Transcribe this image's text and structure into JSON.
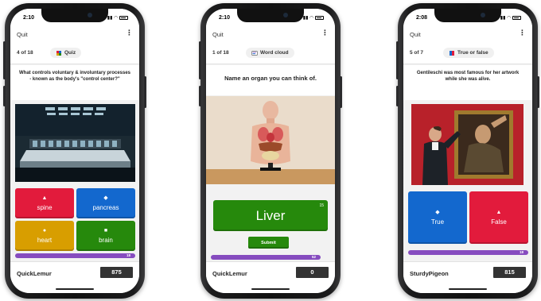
{
  "phones": [
    {
      "status_time": "2:10",
      "quit_label": "Quit",
      "counter": "4 of 18",
      "type_label": "Quiz",
      "question": "What controls voluntary & involuntary processes - known as the body's \"control center?\"",
      "answers": [
        {
          "label": "spine",
          "shape": "▲",
          "color": "#e21b3c"
        },
        {
          "label": "pancreas",
          "shape": "◆",
          "color": "#1368ce"
        },
        {
          "label": "heart",
          "shape": "●",
          "color": "#d89e00"
        },
        {
          "label": "brain",
          "shape": "■",
          "color": "#26890c"
        }
      ],
      "progress": {
        "value": "18",
        "fraction": 1.0
      },
      "player_name": "QuickLemur",
      "score": "875"
    },
    {
      "status_time": "2:10",
      "quit_label": "Quit",
      "counter": "1 of 18",
      "type_label": "Word cloud",
      "question": "Name an organ you can think of.",
      "answer_text": "Liver",
      "char_count": "15",
      "submit_label": "Submit",
      "progress": {
        "value": "52",
        "fraction": 1.0
      },
      "player_name": "QuickLemur",
      "score": "0"
    },
    {
      "status_time": "2:08",
      "quit_label": "Quit",
      "counter": "5 of 7",
      "type_label": "True or false",
      "question": "Gentileschi was most famous for her artwork while she was alive.",
      "answers": [
        {
          "label": "True",
          "shape": "◆",
          "color": "#1368ce"
        },
        {
          "label": "False",
          "shape": "▲",
          "color": "#e21b3c"
        }
      ],
      "progress": {
        "value": "18",
        "fraction": 1.0
      },
      "player_name": "SturdyPigeon",
      "score": "815"
    }
  ],
  "icons": {
    "quiz": "quiz-icon",
    "word_cloud": "word-cloud-icon",
    "true_false": "true-false-icon",
    "more": "more-vertical-icon"
  },
  "colors": {
    "red": "#e21b3c",
    "blue": "#1368ce",
    "gold": "#d89e00",
    "green": "#26890c",
    "purple": "#864cbf"
  }
}
